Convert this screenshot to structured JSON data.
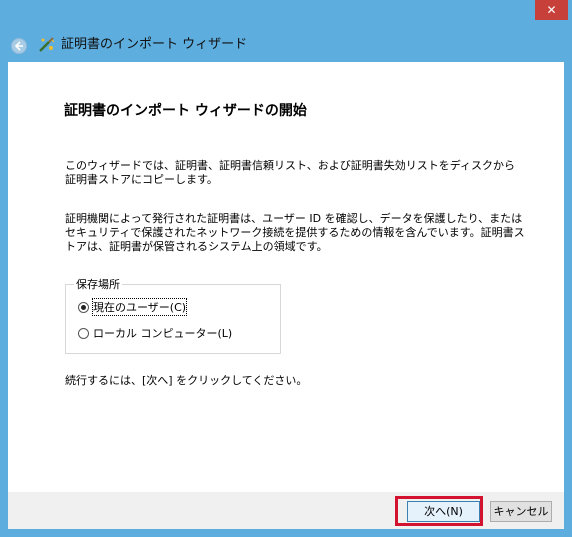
{
  "window": {
    "title": "証明書のインポート ウィザード",
    "close_label": "✕"
  },
  "content": {
    "heading": "証明書のインポート ウィザードの開始",
    "para1": "このウィザードでは、証明書、証明書信頼リスト、および証明書失効リストをディスクから証明書ストアにコピーします。",
    "para2": "証明機関によって発行された証明書は、ユーザー ID を確認し、データを保護したり、またはセキュリティで保護されたネットワーク接続を提供するための情報を含んでいます。証明書ストアは、証明書が保管されるシステム上の領域です。",
    "store_location": {
      "label": "保存場所",
      "options": [
        {
          "label": "現在のユーザー(C)",
          "selected": true
        },
        {
          "label": "ローカル コンピューター(L)",
          "selected": false
        }
      ]
    },
    "continue_text": "続行するには、[次へ] をクリックしてください。"
  },
  "footer": {
    "next_label": "次へ(N)",
    "cancel_label": "キャンセル"
  },
  "colors": {
    "frame": "#5dadde",
    "close": "#c7403a",
    "highlight": "#d2122e"
  },
  "icons": {
    "back": "back-arrow-icon",
    "wizard": "certificate-wizard-icon"
  }
}
